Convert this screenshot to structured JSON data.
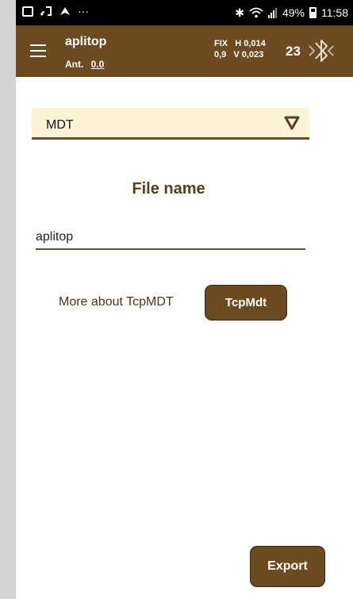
{
  "statusbar": {
    "left_icons": [
      "gallery-icon",
      "cast-icon",
      "navigation-icon"
    ],
    "overflow": "···",
    "bluetooth_symbol": "✱",
    "battery_percent": "49%",
    "time": "11:58"
  },
  "appbar": {
    "title": "aplitop",
    "ant_label": "Ant.",
    "ant_value": "0.0",
    "fix_label": "FIX",
    "h_value": "H 0,014",
    "pdop": "0,9",
    "v_value": "V 0,023",
    "satellites": "23"
  },
  "form": {
    "select_value": "MDT",
    "file_name_label": "File name",
    "file_name_value": "aplitop",
    "more_about_text": "More about TcpMDT",
    "tcpmdt_button": "TcpMdt",
    "export_button": "Export"
  },
  "colors": {
    "primary": "#6b4b1f",
    "select_bg": "#fdf3d7",
    "label": "#5a3e17"
  }
}
